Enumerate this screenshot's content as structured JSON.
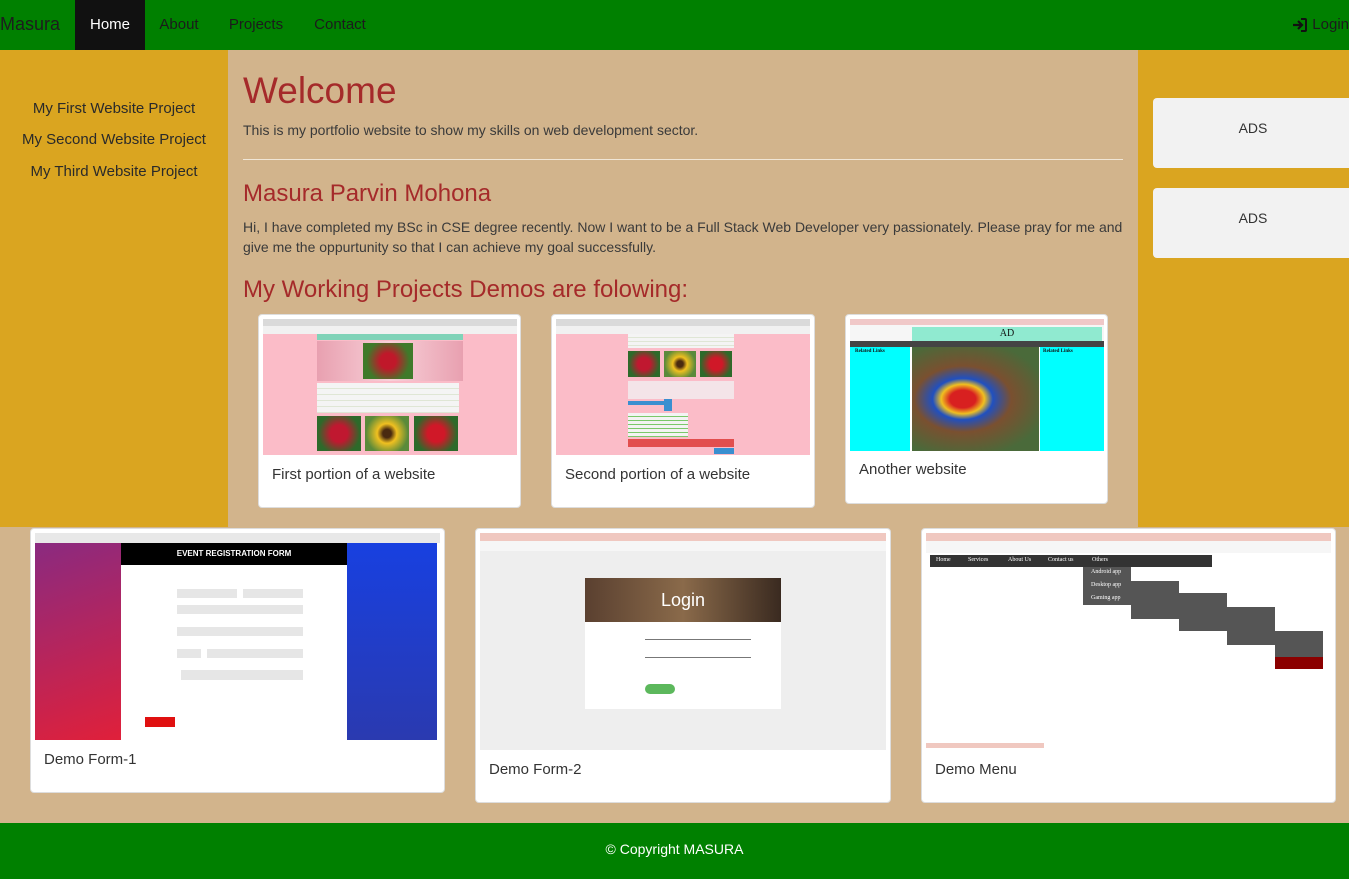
{
  "nav": {
    "brand": "Masura",
    "items": [
      {
        "label": "Home"
      },
      {
        "label": "About"
      },
      {
        "label": "Projects"
      },
      {
        "label": "Contact"
      }
    ],
    "login_label": "Login"
  },
  "sidebar": {
    "links": [
      {
        "label": "My First Website Project"
      },
      {
        "label": "My Second Website Project"
      },
      {
        "label": "My Third Website Project"
      }
    ]
  },
  "main": {
    "title": "Welcome",
    "intro": "This is my portfolio website to show my skills on web development sector.",
    "name": "Masura Parvin Mohona",
    "bio": "Hi, I have completed my BSc in CSE degree recently. Now I want to be a Full Stack Web Developer very passionately. Please pray for me and give me the oppurtunity so that I can achieve my goal successfully.",
    "demos_heading": "My Working Projects Demos are folowing:"
  },
  "ads": [
    {
      "label": "ADS"
    },
    {
      "label": "ADS"
    }
  ],
  "cards": [
    {
      "caption": "First portion of a website"
    },
    {
      "caption": "Second portion of a website"
    },
    {
      "caption": "Another website"
    },
    {
      "caption": "Demo Form-1"
    },
    {
      "caption": "Demo Form-2"
    },
    {
      "caption": "Demo Menu"
    }
  ],
  "thumbs": {
    "ad_banner": "AD",
    "related_links": "Related Links",
    "event_form_title": "EVENT REGISTRATION FORM",
    "login_title": "Login",
    "menu_items": [
      "Home",
      "Services",
      "About Us",
      "Contact us",
      "Others"
    ],
    "submenu": [
      "Android app",
      "Desktop app",
      "Gaming app"
    ]
  },
  "footer": {
    "copyright": "© Copyright MASURA"
  },
  "colors": {
    "nav_bg": "#008000",
    "sidebar_bg": "#daa520",
    "main_bg": "#d2b48c",
    "heading": "#a52a2a"
  }
}
